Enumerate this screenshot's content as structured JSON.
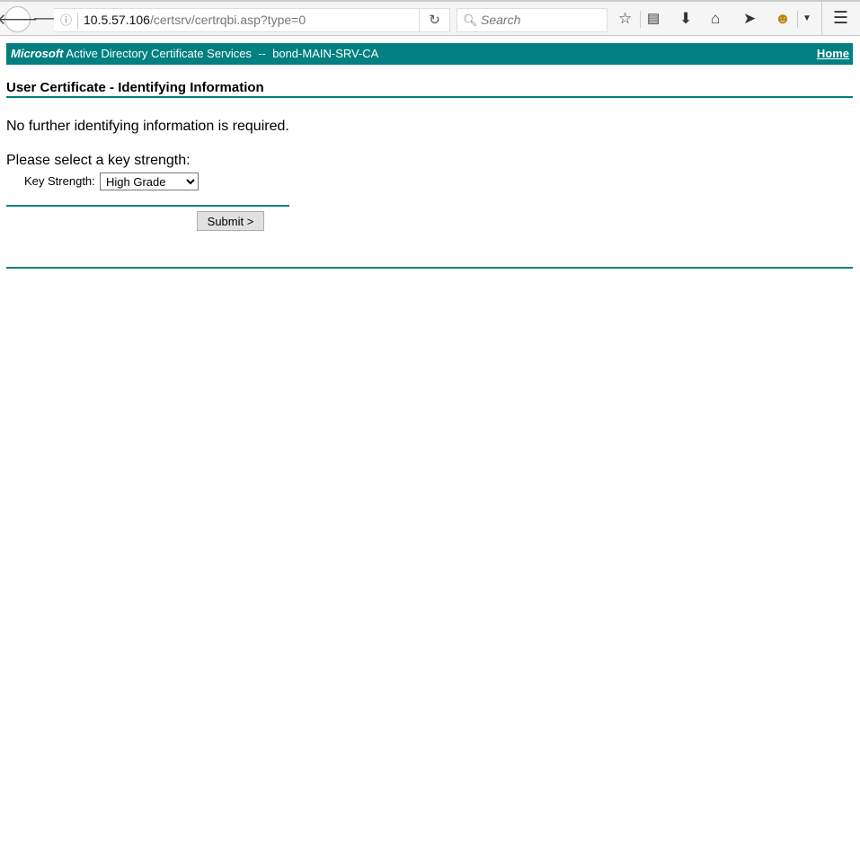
{
  "browser": {
    "url_host": "10.5.57.106",
    "url_path": "/certsrv/certrqbi.asp?type=0",
    "search_placeholder": "Search",
    "icons": [
      "back-icon",
      "forward-icon",
      "info-icon",
      "reload-icon",
      "search-icon",
      "bookmark-star-icon",
      "reading-list-icon",
      "download-icon",
      "home-icon",
      "send-icon",
      "extension-monkey-icon",
      "dropdown-icon",
      "menu-icon"
    ]
  },
  "header": {
    "brand": "Microsoft",
    "title": " Active Directory Certificate Services  --  bond-MAIN-SRV-CA",
    "home_link": "Home"
  },
  "page": {
    "title": "User Certificate - Identifying Information",
    "info_text": "No further identifying information is required.",
    "prompt": "Please select a key strength:",
    "key_strength_label": "Key Strength:",
    "key_strength_value": "High Grade",
    "submit_label": "Submit >"
  },
  "colors": {
    "accent": "#008080"
  }
}
